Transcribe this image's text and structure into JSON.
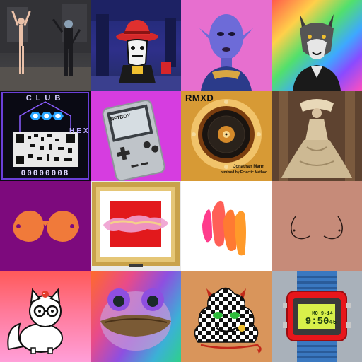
{
  "gallery": {
    "tiles": [
      {
        "name": "dancers-in-club"
      },
      {
        "name": "cowboy-hat-avatar"
      },
      {
        "name": "blue-alien-portrait"
      },
      {
        "name": "wolf-leather-jacket"
      },
      {
        "name": "club-hex-qr",
        "title": "CLUB",
        "side_text": "HEX",
        "counter": "00000008"
      },
      {
        "name": "nftboy-handheld",
        "label": "NFTBOY"
      },
      {
        "name": "rmxd-record",
        "title": "RMXD",
        "artist": "Jonathan Mann",
        "credit": "remixed by Eclectic Method"
      },
      {
        "name": "ornate-gown"
      },
      {
        "name": "orange-shapes-on-purple"
      },
      {
        "name": "framed-red-square"
      },
      {
        "name": "pink-orange-brush-strokes"
      },
      {
        "name": "line-drawing-on-skin"
      },
      {
        "name": "cat-with-glasses"
      },
      {
        "name": "rainbow-frog"
      },
      {
        "name": "checkered-poop-devil"
      },
      {
        "name": "digital-watch",
        "date": "MO 9-14",
        "time": "9:50",
        "seconds": "45"
      }
    ]
  },
  "colors": {
    "club_hex_accent": "#2aa6ff",
    "nftboy_bg": "#d63de0",
    "rmxd_bg": "#d79a35",
    "purple_bg": "#7d0a7d",
    "watch_red": "#e8161b",
    "watch_lcd": "#d8f04a"
  }
}
